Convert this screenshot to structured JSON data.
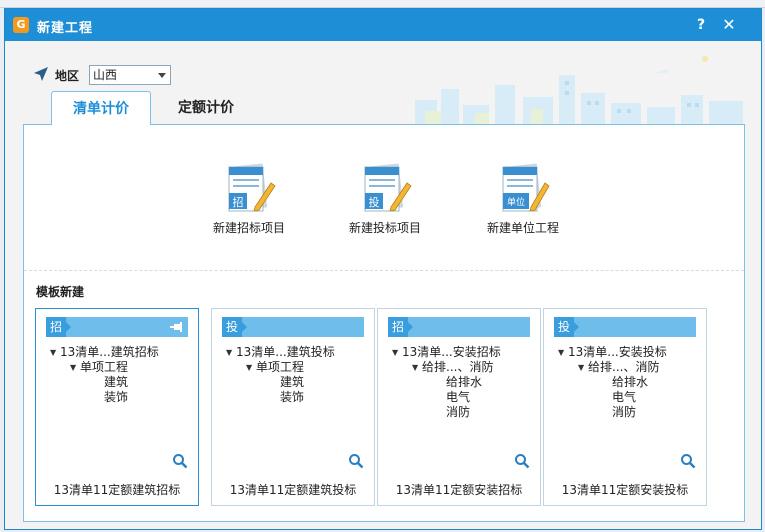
{
  "window": {
    "title": "新建工程",
    "help_label": "?",
    "close_label": "✕"
  },
  "region": {
    "label": "地区",
    "value": "山西"
  },
  "tabs": [
    {
      "label": "清单计价",
      "active": true
    },
    {
      "label": "定额计价",
      "active": false
    }
  ],
  "actions": [
    {
      "badge": "招",
      "label": "新建招标项目"
    },
    {
      "badge": "投",
      "label": "新建投标项目"
    },
    {
      "badge": "单位",
      "label": "新建单位工程"
    }
  ],
  "templates": {
    "heading": "模板新建",
    "cards": [
      {
        "tag": "招",
        "root": "13清单...建筑招标",
        "child": "单项工程",
        "leaves": [
          "建筑",
          "装饰"
        ],
        "caption": "13清单11定额建筑招标"
      },
      {
        "tag": "投",
        "root": "13清单...建筑投标",
        "child": "单项工程",
        "leaves": [
          "建筑",
          "装饰"
        ],
        "caption": "13清单11定额建筑投标"
      },
      {
        "tag": "招",
        "root": "13清单...安装招标",
        "child": "给排...、消防",
        "leaves": [
          "给排水",
          "电气",
          "消防"
        ],
        "caption": "13清单11定额安装招标"
      },
      {
        "tag": "投",
        "root": "13清单...安装投标",
        "child": "给排...、消防",
        "leaves": [
          "给排水",
          "电气",
          "消防"
        ],
        "caption": "13清单11定额安装投标"
      }
    ]
  },
  "colors": {
    "titlebar": "#1e8fd6",
    "accent": "#1e8fd6",
    "card_header": "#6fbdeb",
    "logo": "#f39a1e"
  }
}
